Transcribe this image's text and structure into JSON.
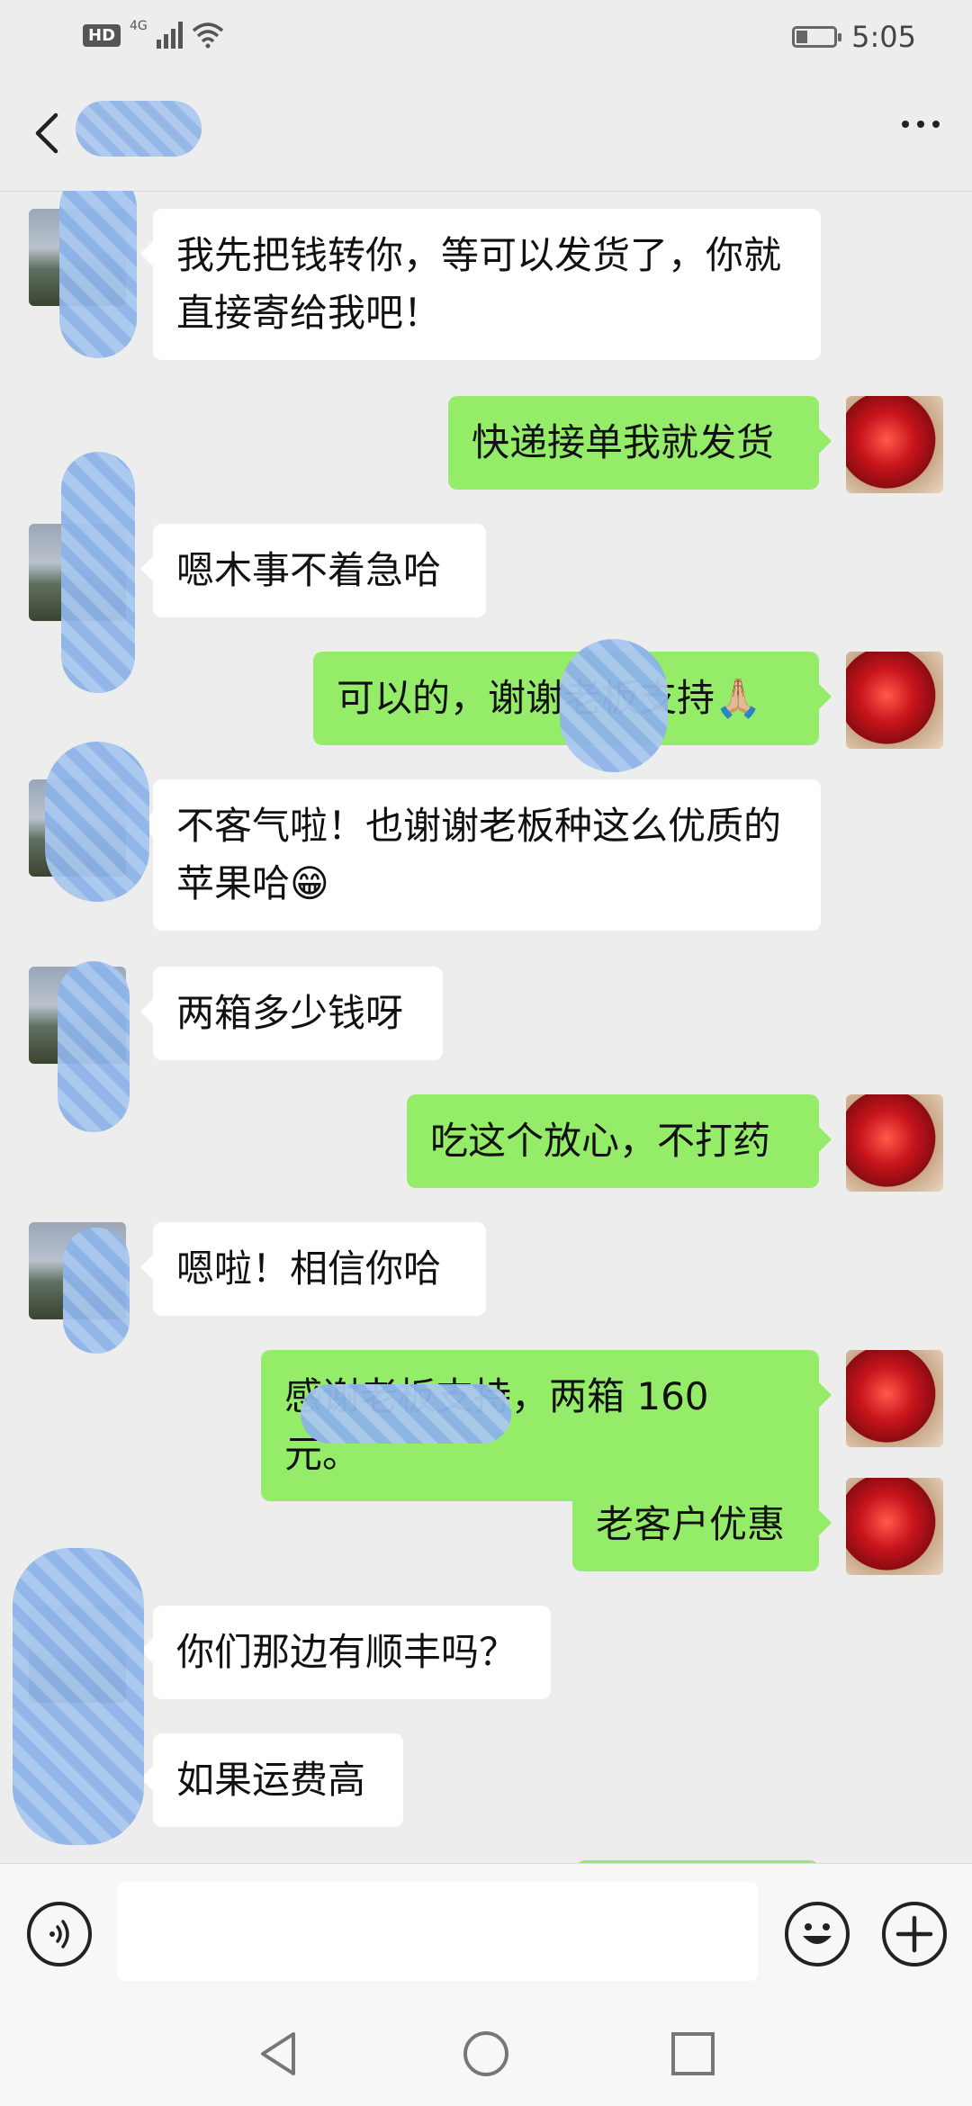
{
  "status_bar": {
    "hd": "HD",
    "network": "4G",
    "battery_level": 0.3,
    "time": "5:05"
  },
  "header": {
    "contact_name": "",
    "back_icon": "chevron-left-icon",
    "more_icon": "more-dots-icon"
  },
  "messages": [
    {
      "side": "left",
      "text": "我先把钱转你，等可以发货了，你就直接寄给我吧！"
    },
    {
      "side": "right",
      "text": "快递接单我就发货"
    },
    {
      "side": "left",
      "text": "嗯木事不着急哈"
    },
    {
      "side": "right",
      "text": "可以的，谢谢老板支持🙏🏼"
    },
    {
      "side": "left",
      "text": "不客气啦！也谢谢老板种这么优质的苹果哈😁"
    },
    {
      "side": "left",
      "text": "两箱多少钱呀"
    },
    {
      "side": "right",
      "text": "吃这个放心，不打药"
    },
    {
      "side": "left",
      "text": "嗯啦！相信你哈"
    },
    {
      "side": "right",
      "text": "感谢老板支持，两箱 160 元。"
    },
    {
      "side": "right",
      "text": "老客户优惠"
    },
    {
      "side": "left",
      "text": "你们那边有顺丰吗？"
    },
    {
      "side": "left",
      "text": "如果运费高"
    }
  ],
  "input_bar": {
    "placeholder": "",
    "voice_icon": "voice-icon",
    "emoji_icon": "emoji-icon",
    "plus_icon": "plus-icon"
  },
  "system_nav": {
    "back_icon": "triangle-back-icon",
    "home_icon": "circle-home-icon",
    "recents_icon": "square-recents-icon"
  },
  "colors": {
    "background": "#ededed",
    "bubble_self": "#95ec69",
    "bubble_other": "#ffffff"
  }
}
